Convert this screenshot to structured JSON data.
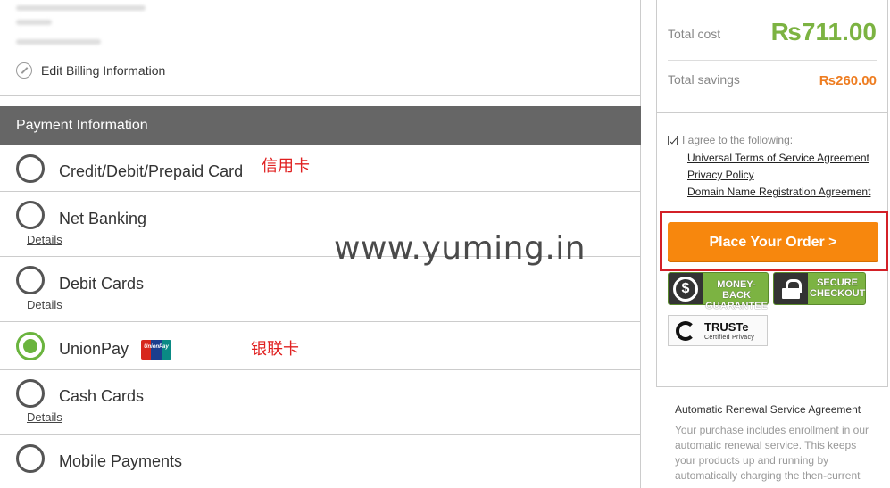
{
  "billing": {
    "edit_label": "Edit Billing Information"
  },
  "payment": {
    "header": "Payment Information",
    "options": [
      {
        "label": "Credit/Debit/Prepaid Card",
        "selected": false,
        "note": "信用卡"
      },
      {
        "label": "Net Banking",
        "selected": false,
        "details": "Details"
      },
      {
        "label": "Debit Cards",
        "selected": false,
        "details": "Details"
      },
      {
        "label": "UnionPay",
        "selected": true,
        "note": "银联卡",
        "logo": "unionpay-logo"
      },
      {
        "label": "Cash Cards",
        "selected": false,
        "details": "Details"
      },
      {
        "label": "Mobile Payments",
        "selected": false
      }
    ]
  },
  "watermark": "www.yuming.in",
  "summary": {
    "total_label": "Total cost",
    "total_value": "₨711.00",
    "savings_label": "Total savings",
    "savings_value": "₨260.00"
  },
  "agreement": {
    "checked": true,
    "intro": "I agree to the following:",
    "links": [
      "Universal Terms of Service Agreement",
      "Privacy Policy",
      "Domain Name Registration Agreement"
    ]
  },
  "order_button": "Place Your Order >",
  "badges": {
    "money_back_line1": "MONEY-BACK",
    "money_back_line2": "GUARANTEE",
    "money_back_symbol": "$",
    "secure_line1": "SECURE",
    "secure_line2": "CHECKOUT",
    "truste_name": "TRUSTe",
    "truste_sub": "Certified Privacy"
  },
  "renewal": {
    "title": "Automatic Renewal Service Agreement",
    "body": "Your purchase includes enrollment in our automatic renewal service. This keeps your products up and running by automatically charging the then-current"
  },
  "colors": {
    "accent_green": "#7cb342",
    "order_orange": "#f7870d",
    "savings_orange": "#ee7d21",
    "highlight_red": "#d32027",
    "annotation_red": "#e02020",
    "header_gray": "#666666"
  }
}
